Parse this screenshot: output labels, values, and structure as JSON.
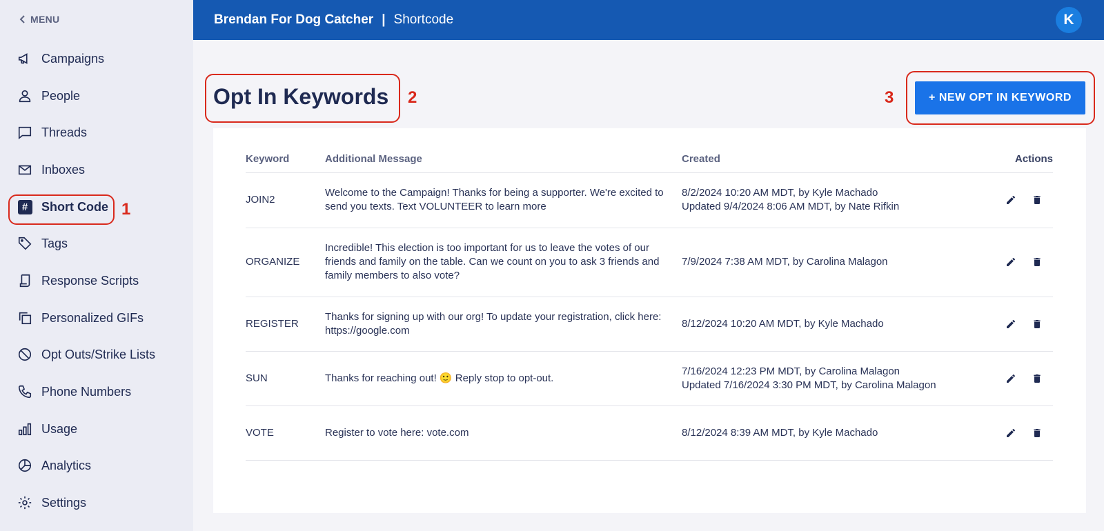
{
  "sidebar": {
    "menu_label": "MENU",
    "items": [
      {
        "label": "Campaigns",
        "icon": "megaphone-icon"
      },
      {
        "label": "People",
        "icon": "person-icon"
      },
      {
        "label": "Threads",
        "icon": "chat-bubble-icon"
      },
      {
        "label": "Inboxes",
        "icon": "mail-icon"
      },
      {
        "label": "Short Code",
        "icon": "hash-icon",
        "active": true
      },
      {
        "label": "Tags",
        "icon": "tag-icon"
      },
      {
        "label": "Response Scripts",
        "icon": "script-icon"
      },
      {
        "label": "Personalized GIFs",
        "icon": "copy-icon"
      },
      {
        "label": "Opt Outs/Strike Lists",
        "icon": "block-icon"
      },
      {
        "label": "Phone Numbers",
        "icon": "phone-icon"
      },
      {
        "label": "Usage",
        "icon": "bar-chart-icon"
      },
      {
        "label": "Analytics",
        "icon": "pie-chart-icon"
      },
      {
        "label": "Settings",
        "icon": "gear-icon"
      }
    ]
  },
  "header": {
    "org_name": "Brendan For Dog Catcher",
    "separator": "|",
    "section": "Shortcode",
    "avatar_initial": "K"
  },
  "annotations": [
    "1",
    "2",
    "3"
  ],
  "main": {
    "title": "Opt In Keywords",
    "new_button_label": "+ NEW OPT IN KEYWORD",
    "table": {
      "columns": [
        "Keyword",
        "Additional Message",
        "Created",
        "Actions"
      ],
      "rows": [
        {
          "keyword": "JOIN2",
          "message": "Welcome to the Campaign! Thanks for being a supporter. We're excited to send you texts. Text VOLUNTEER to learn more",
          "created": "8/2/2024 10:20 AM MDT, by Kyle Machado",
          "updated": "Updated 9/4/2024 8:06 AM MDT, by Nate Rifkin"
        },
        {
          "keyword": "ORGANIZE",
          "message": "Incredible! This election is too important for us to leave the votes of our friends and family on the table. Can we count on you to ask 3 friends and family members to also vote?",
          "created": "7/9/2024 7:38 AM MDT, by Carolina Malagon",
          "updated": ""
        },
        {
          "keyword": "REGISTER",
          "message": "Thanks for signing up with our org! To update your registration, click here: https://google.com",
          "created": "8/12/2024 10:20 AM MDT, by Kyle Machado",
          "updated": ""
        },
        {
          "keyword": "SUN",
          "message": "Thanks for reaching out! 🙂 Reply stop to opt-out.",
          "created": "7/16/2024 12:23 PM MDT, by Carolina Malagon",
          "updated": "Updated 7/16/2024 3:30 PM MDT, by Carolina Malagon"
        },
        {
          "keyword": "VOTE",
          "message": "Register to vote here: vote.com",
          "created": "8/12/2024 8:39 AM MDT, by Kyle Machado",
          "updated": ""
        }
      ]
    }
  }
}
